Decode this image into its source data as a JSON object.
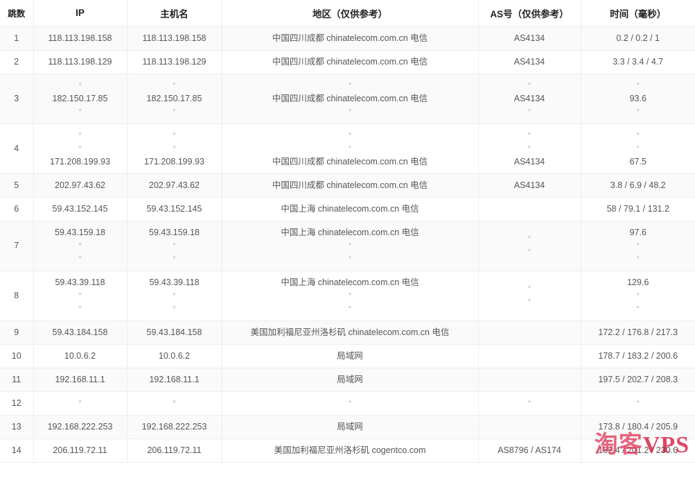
{
  "table": {
    "name": "traceroute-result-table",
    "columns": [
      {
        "key": "hop",
        "label": "跳数"
      },
      {
        "key": "ip",
        "label": "IP"
      },
      {
        "key": "host",
        "label": "主机名"
      },
      {
        "key": "geo",
        "label": "地区（仅供参考）"
      },
      {
        "key": "asn",
        "label": "AS号（仅供参考）"
      },
      {
        "key": "time",
        "label": "时间（毫秒）"
      }
    ],
    "rows": [
      {
        "hop": "1",
        "ip": [
          "118.113.198.158"
        ],
        "host": [
          "118.113.198.158"
        ],
        "geo": [
          "中国四川成都 chinatelecom.com.cn 电信"
        ],
        "asn": [
          "AS4134"
        ],
        "time": [
          "0.2 / 0.2 / 1"
        ]
      },
      {
        "hop": "2",
        "ip": [
          "118.113.198.129"
        ],
        "host": [
          "118.113.198.129"
        ],
        "geo": [
          "中国四川成都 chinatelecom.com.cn 电信"
        ],
        "asn": [
          "AS4134"
        ],
        "time": [
          "3.3 / 3.4 / 4.7"
        ]
      },
      {
        "hop": "3",
        "ip": [
          "*",
          "182.150.17.85",
          "*"
        ],
        "host": [
          "*",
          "182.150.17.85",
          "*"
        ],
        "geo": [
          "*",
          "中国四川成都 chinatelecom.com.cn 电信",
          "*"
        ],
        "asn": [
          "*",
          "AS4134",
          "*"
        ],
        "time": [
          "*",
          "93.6",
          "*"
        ]
      },
      {
        "hop": "4",
        "ip": [
          "*",
          "*",
          "171.208.199.93"
        ],
        "host": [
          "*",
          "*",
          "171.208.199.93"
        ],
        "geo": [
          "*",
          "*",
          "中国四川成都 chinatelecom.com.cn 电信"
        ],
        "asn": [
          "*",
          "*",
          "AS4134"
        ],
        "time": [
          "*",
          "*",
          "67.5"
        ]
      },
      {
        "hop": "5",
        "ip": [
          "202.97.43.62"
        ],
        "host": [
          "202.97.43.62"
        ],
        "geo": [
          "中国四川成都 chinatelecom.com.cn 电信"
        ],
        "asn": [
          "AS4134"
        ],
        "time": [
          "3.8 / 6.9 / 48.2"
        ]
      },
      {
        "hop": "6",
        "ip": [
          "59.43.152.145"
        ],
        "host": [
          "59.43.152.145"
        ],
        "geo": [
          "中国上海 chinatelecom.com.cn 电信"
        ],
        "asn": [
          ""
        ],
        "time": [
          "58 / 79.1 / 131.2"
        ]
      },
      {
        "hop": "7",
        "ip": [
          "59.43.159.18",
          "*",
          "*"
        ],
        "host": [
          "59.43.159.18",
          "*",
          "*"
        ],
        "geo": [
          "中国上海 chinatelecom.com.cn 电信",
          "*",
          "*"
        ],
        "asn": [
          "",
          "*",
          "*"
        ],
        "time": [
          "97.6",
          "*",
          "*"
        ]
      },
      {
        "hop": "8",
        "ip": [
          "59.43.39.118",
          "*",
          "*"
        ],
        "host": [
          "59.43.39.118",
          "*",
          "*"
        ],
        "geo": [
          "中国上海 chinatelecom.com.cn 电信",
          "*",
          "*"
        ],
        "asn": [
          "",
          "*",
          "*"
        ],
        "time": [
          "129.6",
          "*",
          "*"
        ]
      },
      {
        "hop": "9",
        "ip": [
          "59.43.184.158"
        ],
        "host": [
          "59.43.184.158"
        ],
        "geo": [
          "美国加利福尼亚州洛杉矶 chinatelecom.com.cn 电信"
        ],
        "asn": [
          ""
        ],
        "time": [
          "172.2 / 176.8 / 217.3"
        ]
      },
      {
        "hop": "10",
        "ip": [
          "10.0.6.2"
        ],
        "host": [
          "10.0.6.2"
        ],
        "geo": [
          "局域网"
        ],
        "asn": [
          ""
        ],
        "time": [
          "178.7 / 183.2 / 200.6"
        ]
      },
      {
        "hop": "11",
        "ip": [
          "192.168.11.1"
        ],
        "host": [
          "192.168.11.1"
        ],
        "geo": [
          "局域网"
        ],
        "asn": [
          ""
        ],
        "time": [
          "197.5 / 202.7 / 208.3"
        ]
      },
      {
        "hop": "12",
        "ip": [
          "*"
        ],
        "host": [
          "*"
        ],
        "geo": [
          "*"
        ],
        "asn": [
          "*"
        ],
        "time": [
          "*"
        ]
      },
      {
        "hop": "13",
        "ip": [
          "192.168.222.253"
        ],
        "host": [
          "192.168.222.253"
        ],
        "geo": [
          "局域网"
        ],
        "asn": [
          ""
        ],
        "time": [
          "173.8 / 180.4 / 205.9"
        ]
      },
      {
        "hop": "14",
        "ip": [
          "206.119.72.11"
        ],
        "host": [
          "206.119.72.11"
        ],
        "geo": [
          "美国加利福尼亚州洛杉矶 cogentco.com"
        ],
        "asn": [
          "AS8796 / AS174"
        ],
        "time": [
          "182.4 / 201.2 / 230.6"
        ]
      }
    ]
  },
  "watermark": {
    "text_cn": "淘客",
    "text_en": "VPS",
    "color": "#e8254b"
  },
  "colors": {
    "link": "#8ab6d6",
    "text": "#3c3c3c",
    "muted": "#bdbdbd",
    "border": "#ededed",
    "stripe": "#fafafa",
    "watermark": "#e8254b"
  }
}
